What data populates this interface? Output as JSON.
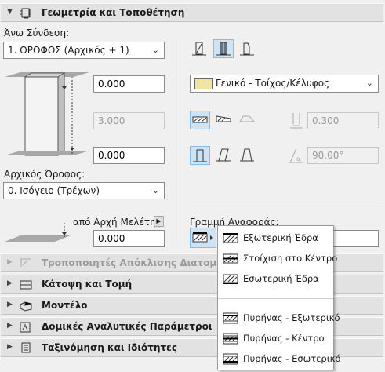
{
  "sections": {
    "geometry": {
      "title": "Γεωμετρία και Τοποθέτηση"
    },
    "profile_mods": {
      "title": "Τροποποιητές Απόκλισης Διατομής"
    },
    "floorplan": {
      "title": "Κάτοψη και Τομή"
    },
    "model": {
      "title": "Μοντέλο"
    },
    "structural": {
      "title": "Δομικές Αναλυτικές Παράμετροι"
    },
    "classification": {
      "title": "Ταξινόμηση και Ιδιότητες"
    }
  },
  "geometry": {
    "top_link_label": "Άνω Σύνδεση:",
    "top_link_value": "1. ΟΡΟΦΟΣ (Αρχικός + 1)",
    "top_offset": "0.000",
    "height": "3.000",
    "bottom_offset": "0.000",
    "home_story_label": "Αρχικός Όροφος:",
    "home_story_value": "0. Ισόγειο (Τρέχων)",
    "project_zero_label": "από Αρχή Μελέτης",
    "project_zero_value": "0.000",
    "composite_value": "Γενικό - Τοίχος/Κέλυφος",
    "thickness": "0.300",
    "angle": "90.00°",
    "reference_line_label": "Γραμμή Αναφοράς:"
  },
  "reference_menu": {
    "items": [
      {
        "label": "Εξωτερική Έδρα"
      },
      {
        "label": "Στοίχιση στο Κέντρο"
      },
      {
        "label": "Εσωτερική Έδρα"
      },
      {
        "label": "Πυρήνας - Εξωτερικό"
      },
      {
        "label": "Πυρήνας - Κέντρο"
      },
      {
        "label": "Πυρήνας - Εσωτερικό"
      }
    ]
  },
  "icons": {
    "collapse": "triangle-down",
    "expand": "triangle-right",
    "dropdown": "chevron-down"
  }
}
